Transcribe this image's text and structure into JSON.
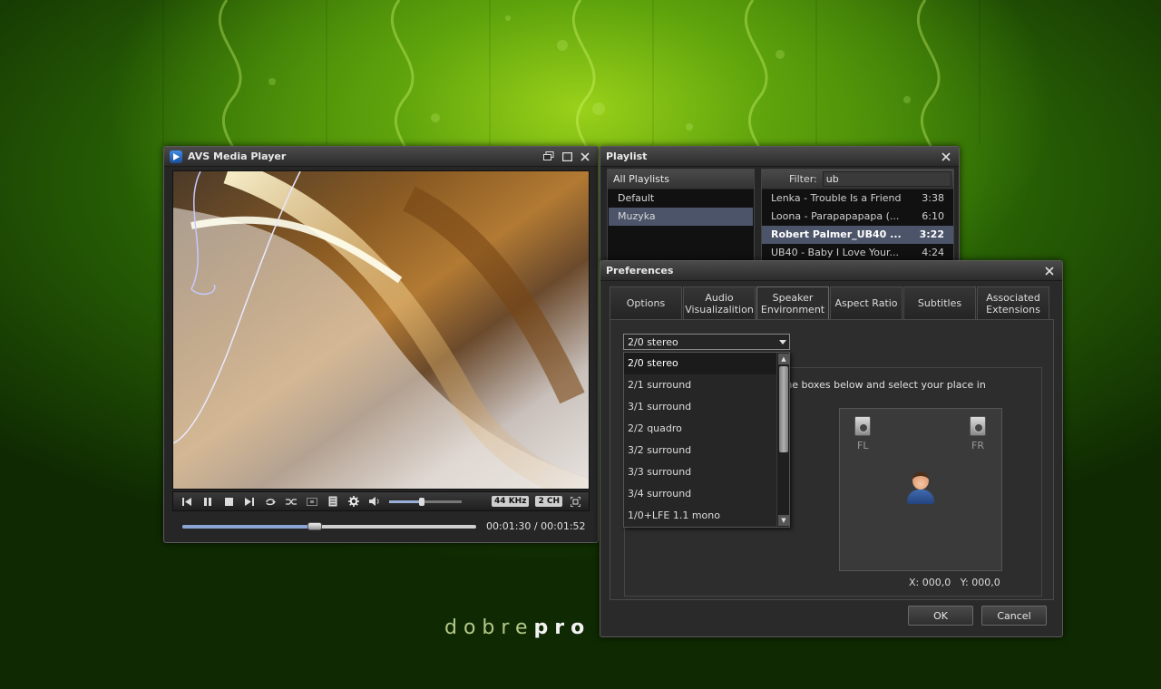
{
  "desktop": {
    "brand_light": "dobre",
    "brand_bold": "pro"
  },
  "player": {
    "title": "AVS Media Player",
    "sample_rate": "44 KHz",
    "channels": "2 CH",
    "current_time": "00:01:30",
    "separator": "/",
    "total_time": "00:01:52",
    "progress_fraction": 0.45,
    "volume_fraction": 0.45
  },
  "playlist": {
    "title": "Playlist",
    "all_playlists_label": "All Playlists",
    "playlists": [
      {
        "name": "Default",
        "selected": false
      },
      {
        "name": "Muzyka",
        "selected": true
      }
    ],
    "filter_label": "Filter:",
    "filter_value": "ub",
    "tracks": [
      {
        "title": "Lenka - Trouble Is a Friend",
        "duration": "3:38",
        "playing": false
      },
      {
        "title": "Loona - Parapapapapa (...",
        "duration": "6:10",
        "playing": false
      },
      {
        "title": "Robert Palmer_UB40 ...",
        "duration": "3:22",
        "playing": true
      },
      {
        "title": "UB40 - Baby I Love Your...",
        "duration": "4:24",
        "playing": false
      }
    ]
  },
  "preferences": {
    "title": "Preferences",
    "tabs": [
      {
        "label": "Options",
        "active": false
      },
      {
        "label": "Audio Visualizalition",
        "active": false
      },
      {
        "label": "Speaker Environment",
        "active": true
      },
      {
        "label": "Aspect Ratio",
        "active": false
      },
      {
        "label": "Subtitles",
        "active": false
      },
      {
        "label": "Associated Extensions",
        "active": false
      }
    ],
    "speaker_config": "2/0 stereo",
    "options": [
      "2/0 stereo",
      "2/1 surround",
      "3/1 surround",
      "2/2 quadro",
      "3/2 surround",
      "3/3 surround",
      "3/4 surround",
      "1/0+LFE 1.1 mono"
    ],
    "instruction": "the boxes below and select your place in",
    "speakers": {
      "fl": "FL",
      "fr": "FR"
    },
    "coord_x_label": "X:",
    "coord_x": "000,0",
    "coord_y_label": "Y:",
    "coord_y": "000,0",
    "ok_label": "OK",
    "cancel_label": "Cancel"
  },
  "colors": {
    "selection": "#4c5469",
    "window_bg": "#262626",
    "accent_blue": "#8aa4d6"
  }
}
